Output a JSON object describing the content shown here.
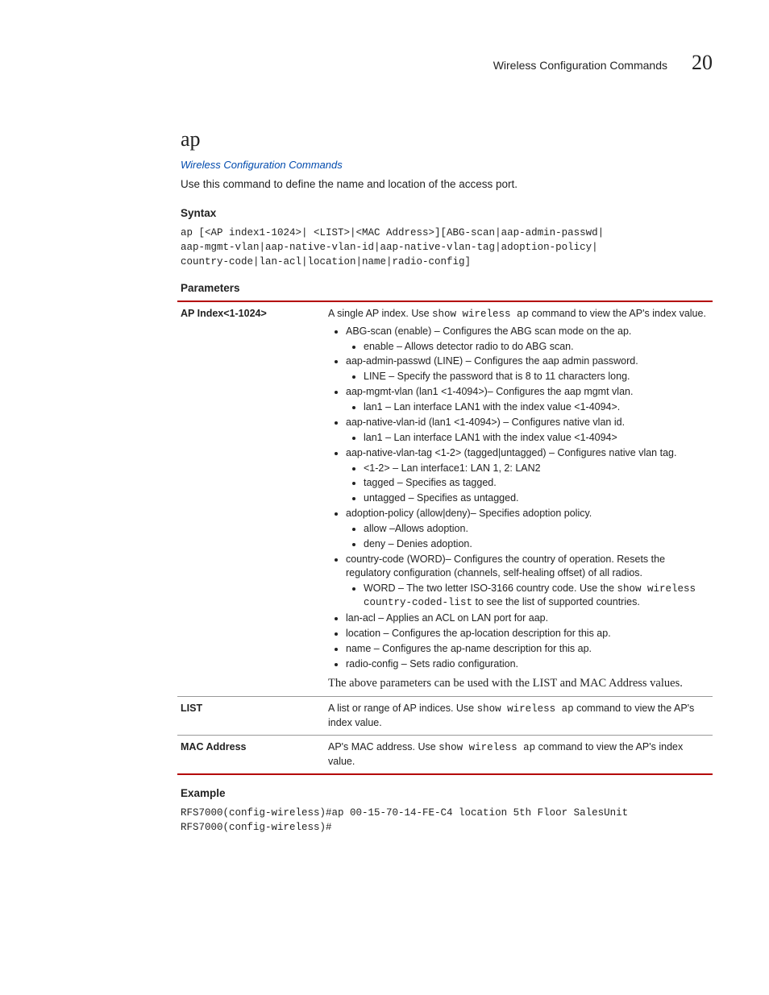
{
  "header": {
    "title": "Wireless Configuration Commands",
    "chapter_number": "20"
  },
  "section_title": "ap",
  "breadcrumb_link": "Wireless Configuration Commands",
  "intro": "Use this command to define the name and location of the access port.",
  "syntax_heading": "Syntax",
  "syntax_code": "ap [<AP index1-1024>| <LIST>|<MAC Address>][ABG-scan|aap-admin-passwd|\naap-mgmt-vlan|aap-native-vlan-id|aap-native-vlan-tag|adoption-policy|\ncountry-code|lan-acl|location|name|radio-config]",
  "parameters_heading": "Parameters",
  "parameters": [
    {
      "name": "AP Index<1-1024>",
      "desc_pre": "A single AP index. Use ",
      "desc_code": "show wireless ap",
      "desc_post": " command to view the AP's index value.",
      "trailer": "The above parameters can be used with the LIST and MAC Address values."
    },
    {
      "name": "LIST",
      "desc_pre": "A list or range of AP indices. Use ",
      "desc_code": "show wireless ap",
      "desc_post": " command to view the AP's index value."
    },
    {
      "name": "MAC Address",
      "desc_pre": "AP's MAC address. Use ",
      "desc_code": "show wireless ap",
      "desc_post": " command to view the AP's index value."
    }
  ],
  "bullets": {
    "abg_scan": {
      "label": "ABG-scan (enable) – Configures the ABG scan mode on the ap.",
      "sub": "enable – Allows detector radio to do ABG scan."
    },
    "aap_admin_passwd": {
      "label": "aap-admin-passwd (LINE) – Configures the aap admin password.",
      "sub": "LINE – Specify the password that is 8 to 11 characters long."
    },
    "aap_mgmt_vlan": {
      "label": "aap-mgmt-vlan (lan1 <1-4094>)– Configures the aap mgmt vlan.",
      "sub": "lan1 – Lan interface LAN1 with the index value <1-4094>."
    },
    "aap_native_vlan_id": {
      "label": "aap-native-vlan-id (lan1 <1-4094>) – Configures native vlan id.",
      "sub": "lan1 – Lan interface LAN1 with the index value <1-4094>"
    },
    "aap_native_vlan_tag": {
      "label": "aap-native-vlan-tag <1-2> (tagged|untagged) – Configures native vlan tag.",
      "sub1": "<1-2> – Lan interface1: LAN 1, 2: LAN2",
      "sub2": "tagged – Specifies as tagged.",
      "sub3": "untagged – Specifies as untagged."
    },
    "adoption_policy": {
      "label": "adoption-policy (allow|deny)– Specifies adoption policy.",
      "sub1": "allow –Allows adoption.",
      "sub2": "deny – Denies adoption."
    },
    "country_code": {
      "label": "country-code (WORD)– Configures the country of operation. Resets the regulatory configuration (channels, self-healing offset) of all radios.",
      "sub_pre": "WORD – The two letter ISO-3166 country code. Use the ",
      "sub_code": "show wireless country-coded-list",
      "sub_post": " to see the list of supported countries."
    },
    "lan_acl": "lan-acl – Applies an ACL on LAN port for aap.",
    "location": "location – Configures the ap-location description for this ap.",
    "name": "name – Configures the ap-name description for this ap.",
    "radio_config": "radio-config – Sets radio configuration."
  },
  "example_heading": "Example",
  "example_code": "RFS7000(config-wireless)#ap 00-15-70-14-FE-C4 location 5th Floor SalesUnit\nRFS7000(config-wireless)#"
}
